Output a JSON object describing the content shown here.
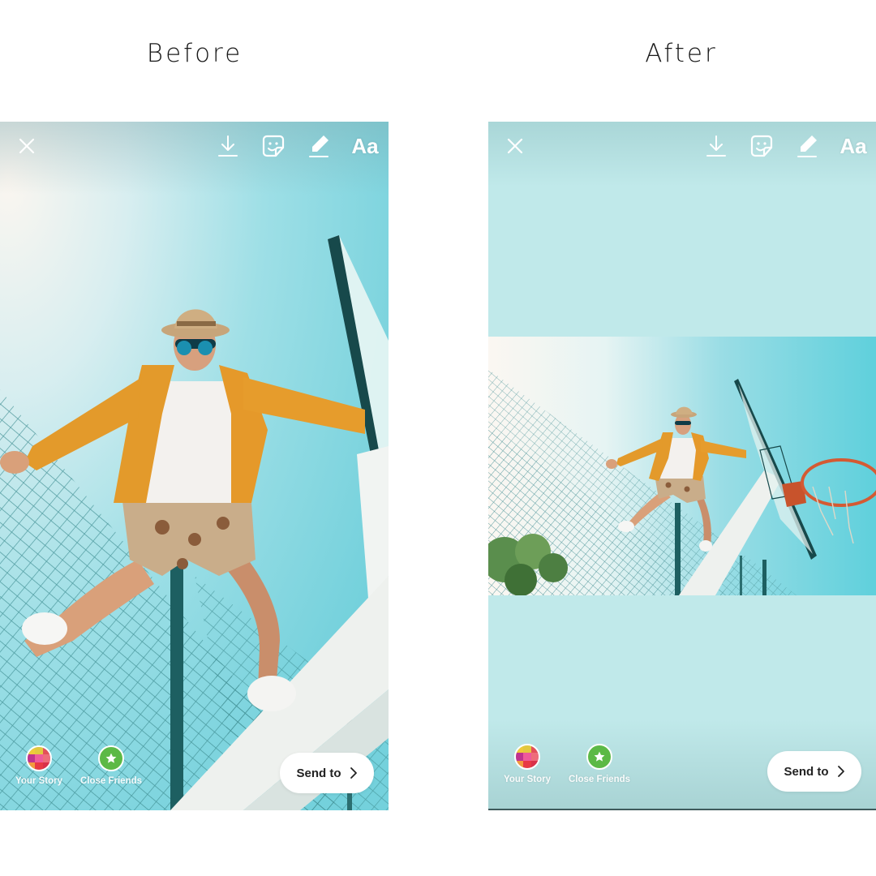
{
  "captions": {
    "before": "Before",
    "after": "After"
  },
  "panels": [
    {
      "id": "before",
      "toolbar": {
        "icons": [
          "close-icon",
          "download-icon",
          "sticker-icon",
          "draw-icon"
        ],
        "text_tool_label": "Aa"
      },
      "share_targets": [
        {
          "label": "Your Story",
          "icon": "your-story-grid-icon"
        },
        {
          "label": "Close Friends",
          "icon": "close-friends-star-icon"
        }
      ],
      "send_button": {
        "label": "Send to",
        "icon": "chevron-right-icon"
      },
      "photo": {
        "layout": "full-bleed",
        "description": "man in orange jacket jumping near basketball hoop against blue sky"
      }
    },
    {
      "id": "after",
      "toolbar": {
        "icons": [
          "close-icon",
          "download-icon",
          "sticker-icon",
          "draw-icon"
        ],
        "text_tool_label": "Aa"
      },
      "share_targets": [
        {
          "label": "Your Story",
          "icon": "your-story-grid-icon"
        },
        {
          "label": "Close Friends",
          "icon": "close-friends-star-icon"
        }
      ],
      "send_button": {
        "label": "Send to",
        "icon": "chevron-right-icon"
      },
      "photo": {
        "layout": "landscape-letterboxed",
        "description": "man in orange jacket jumping near basketball hoop against blue sky"
      },
      "background_color": "#c0e9ea"
    }
  ],
  "colors": {
    "sky_light": "#eaf6f5",
    "sky_blue": "#5fd0dc",
    "jacket_orange": "#e39a2b",
    "close_friends_green": "#5cb946",
    "story_grid": [
      "#f0c93a",
      "#e2c83f",
      "#e4505a",
      "#c0338f",
      "#ef5a9a",
      "#ee6d7a",
      "#f39a3e",
      "#e83a44",
      "#d9314a"
    ]
  }
}
